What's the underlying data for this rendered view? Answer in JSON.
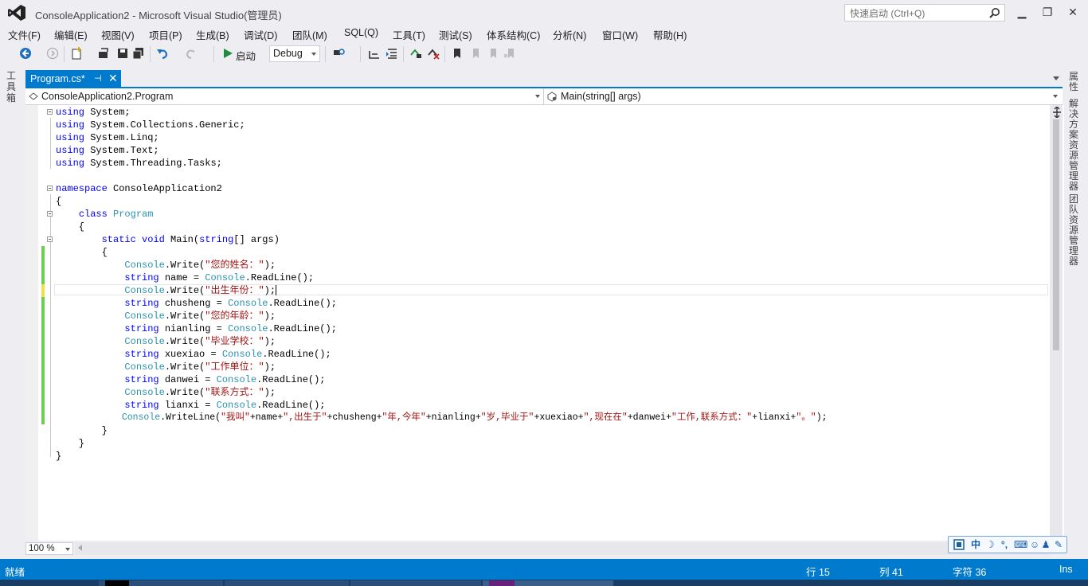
{
  "window": {
    "title": "ConsoleApplication2 - Microsoft Visual Studio(管理员)",
    "quick_launch_placeholder": "快速启动 (Ctrl+Q)",
    "minimize": "▁",
    "restore": "❐",
    "close": "✕"
  },
  "menu": [
    "文件(F)",
    "编辑(E)",
    "视图(V)",
    "项目(P)",
    "生成(B)",
    "调试(D)",
    "团队(M)",
    "SQL(Q)",
    "工具(T)",
    "测试(S)",
    "体系结构(C)",
    "分析(N)",
    "窗口(W)",
    "帮助(H)"
  ],
  "toolbar": {
    "start_label": "启动",
    "config_value": "Debug"
  },
  "side_panels": {
    "left": "工具箱",
    "right": [
      "属性",
      "解决方案资源管理器",
      "团队资源管理器"
    ]
  },
  "tab": {
    "label": "Program.cs*",
    "pin": "⊣",
    "close": "✕"
  },
  "nav": {
    "class_dropdown": "ConsoleApplication2.Program",
    "member_dropdown": "Main(string[] args)"
  },
  "code": {
    "l1": [
      "using",
      " System;"
    ],
    "l2": [
      "using",
      " System.Collections.Generic;"
    ],
    "l3": [
      "using",
      " System.Linq;"
    ],
    "l4": [
      "using",
      " System.Text;"
    ],
    "l5": [
      "using",
      " System.Threading.Tasks;"
    ],
    "l7": [
      "namespace",
      " ConsoleApplication2"
    ],
    "l8": "{",
    "l9": [
      "    ",
      "class",
      " ",
      "Program"
    ],
    "l10": "    {",
    "l11": [
      "        ",
      "static",
      " ",
      "void",
      " Main(",
      "string",
      "[] args)"
    ],
    "l12": "        {",
    "l13": [
      "            ",
      "Console",
      ".Write(",
      "\"您的姓名：\"",
      ");"
    ],
    "l14": [
      "            ",
      "string",
      " name = ",
      "Console",
      ".ReadLine();"
    ],
    "l15": [
      "            ",
      "Console",
      ".Write(",
      "\"出生年份：\"",
      ");"
    ],
    "l16": [
      "            ",
      "string",
      " chusheng = ",
      "Console",
      ".ReadLine();"
    ],
    "l17": [
      "            ",
      "Console",
      ".Write(",
      "\"您的年龄：\"",
      ");"
    ],
    "l18": [
      "            ",
      "string",
      " nianling = ",
      "Console",
      ".ReadLine();"
    ],
    "l19": [
      "            ",
      "Console",
      ".Write(",
      "\"毕业学校：\"",
      ");"
    ],
    "l20": [
      "            ",
      "string",
      " xuexiao = ",
      "Console",
      ".ReadLine();"
    ],
    "l21": [
      "            ",
      "Console",
      ".Write(",
      "\"工作单位：\"",
      ");"
    ],
    "l22": [
      "            ",
      "string",
      " danwei = ",
      "Console",
      ".ReadLine();"
    ],
    "l23": [
      "            ",
      "Console",
      ".Write(",
      "\"联系方式：\"",
      ");"
    ],
    "l24": [
      "            ",
      "string",
      " lianxi = ",
      "Console",
      ".ReadLine();"
    ],
    "l25": [
      "            ",
      "Console",
      ".WriteLine(",
      "\"我叫\"",
      "+name+",
      "\",出生于\"",
      "+chusheng+",
      "\"年,今年\"",
      "+nianling+",
      "\"岁,毕业于\"",
      "+xuexiao+",
      "\",现在在\"",
      "+danwei+",
      "\"工作,联系方式：\"",
      "+lianxi+",
      "\"。\"",
      ");"
    ],
    "l26": "        }",
    "l27": "    }",
    "l28": "}"
  },
  "zoom": "100 %",
  "ime": [
    "中",
    "☽",
    "°,",
    "⌨",
    "☺",
    "♟",
    "✎"
  ],
  "status": {
    "ready": "就绪",
    "line": "行 15",
    "col": "列 41",
    "char": "字符 36",
    "mode": "Ins"
  },
  "colors": {
    "accent": "#007acc",
    "keyword": "#0000ff",
    "type": "#2b91af",
    "string": "#a31515"
  }
}
